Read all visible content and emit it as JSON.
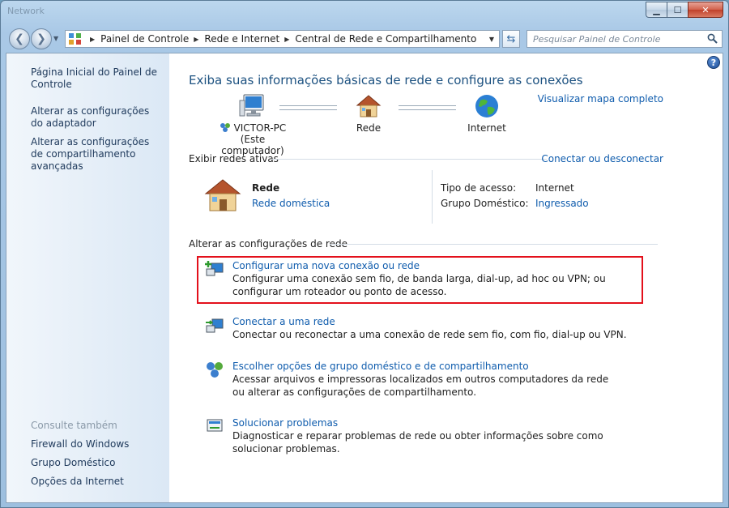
{
  "window": {
    "title": "Network",
    "caption": {
      "minimize": "▁",
      "maximize": "☐",
      "close": "✕"
    }
  },
  "nav": {
    "breadcrumbs": [
      "Painel de Controle",
      "Rede e Internet",
      "Central de Rede e Compartilhamento"
    ],
    "search_placeholder": "Pesquisar Painel de Controle"
  },
  "sidebar": {
    "links": [
      "Página Inicial do Painel de Controle",
      "Alterar as configurações do adaptador",
      "Alterar as configurações de compartilhamento avançadas"
    ],
    "see_also_heading": "Consulte também",
    "see_also": [
      "Firewall do Windows",
      "Grupo Doméstico",
      "Opções da Internet"
    ]
  },
  "main": {
    "title": "Exiba suas informações básicas de rede e configure as conexões",
    "view_full_map": "Visualizar mapa completo",
    "map": {
      "computer_name": "VICTOR-PC",
      "computer_sub": "(Este computador)",
      "network": "Rede",
      "internet": "Internet"
    },
    "active_networks": {
      "heading": "Exibir redes ativas",
      "connect_link": "Conectar ou desconectar",
      "network_name": "Rede",
      "network_type": "Rede doméstica",
      "access_type_label": "Tipo de acesso:",
      "access_type_value": "Internet",
      "homegroup_label": "Grupo Doméstico:",
      "homegroup_value": "Ingressado"
    },
    "change_settings": {
      "heading": "Alterar as configurações de rede",
      "tasks": [
        {
          "title": "Configurar uma nova conexão ou rede",
          "desc": "Configurar uma conexão sem fio, de banda larga, dial-up, ad hoc ou VPN; ou configurar um roteador ou ponto de acesso."
        },
        {
          "title": "Conectar a uma rede",
          "desc": "Conectar ou reconectar a uma conexão de rede sem fio, com fio, dial-up ou VPN."
        },
        {
          "title": "Escolher opções de grupo doméstico e de compartilhamento",
          "desc": "Acessar arquivos e impressoras localizados em outros computadores da rede ou alterar as configurações de compartilhamento."
        },
        {
          "title": "Solucionar problemas",
          "desc": "Diagnosticar e reparar problemas de rede ou obter informações sobre como solucionar problemas."
        }
      ]
    }
  },
  "colors": {
    "link": "#0f5cad",
    "title": "#1c5180",
    "highlight_border": "#e3101b",
    "sidebar_bg": "#dbe8f5"
  }
}
